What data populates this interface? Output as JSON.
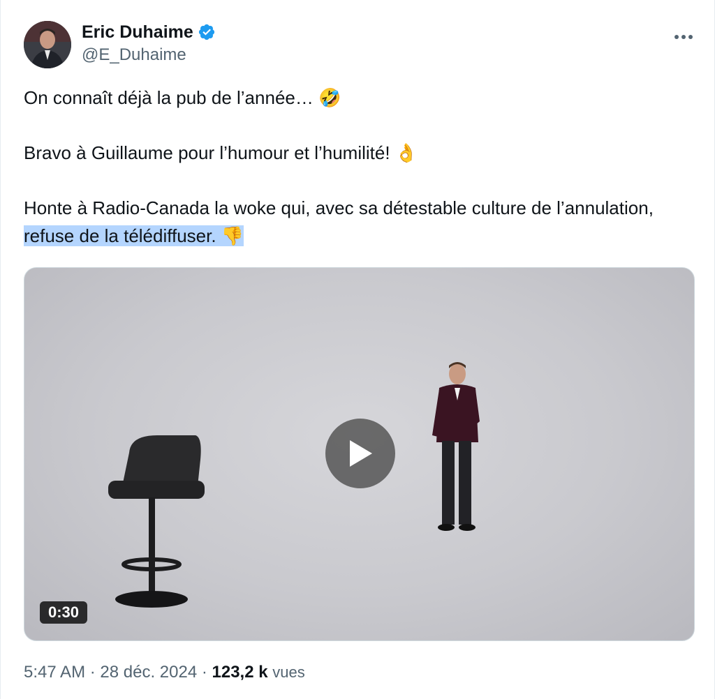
{
  "author": {
    "name": "Eric Duhaime",
    "handle": "@E_Duhaime"
  },
  "more_icon": "more-horizontal-icon",
  "tweet": {
    "line1": "On connaît déjà la pub de l’année… ",
    "emoji1": "🤣",
    "line2": "Bravo à Guillaume pour l’humour et l’humilité! ",
    "emoji2": "👌",
    "line3_a": "Honte à Radio-Canada la woke qui, avec sa détestable culture de l’annulation, ",
    "line3_highlight": "refuse de la télédiffuser. ",
    "emoji3": "👎"
  },
  "video": {
    "duration": "0:30",
    "play_icon": "play-icon"
  },
  "meta": {
    "time": "5:47 AM",
    "separator": " · ",
    "date": "28 déc. 2024",
    "views_count": "123,2 k",
    "views_label": "vues"
  },
  "colors": {
    "verified": "#1d9bf0",
    "secondary_text": "#536471",
    "highlight": "#b4d5fe"
  }
}
